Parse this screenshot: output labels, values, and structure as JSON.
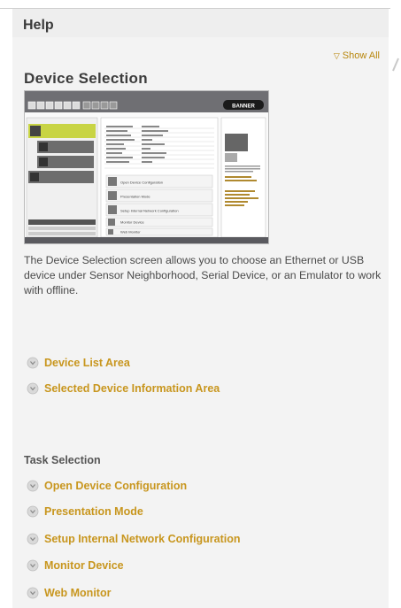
{
  "help": {
    "title": "Help",
    "show_all": "Show All",
    "section_title": "Device Selection",
    "description": "The Device Selection screen allows you to choose an Ethernet or USB device under Sensor Neighborhood, Serial Device, or an Emulator to work with offline.",
    "area_links": [
      {
        "label": "Device List Area"
      },
      {
        "label": "Selected Device Information Area"
      }
    ],
    "task_heading": "Task Selection",
    "task_links": [
      {
        "label": "Open Device Configuration"
      },
      {
        "label": "Presentation Mode"
      },
      {
        "label": "Setup Internal Network Configuration"
      },
      {
        "label": "Monitor Device"
      },
      {
        "label": "Web Monitor"
      }
    ]
  },
  "screenshot": {
    "brand": "BANNER",
    "tasks": [
      "Open Device Configuration",
      "Presentation Mode",
      "Setup Internal Network Configuration",
      "Monitor Device",
      "Web Monitor"
    ]
  },
  "colors": {
    "link": "#c8961e",
    "panel": "#f3f3f3",
    "header": "#eeeeee"
  }
}
